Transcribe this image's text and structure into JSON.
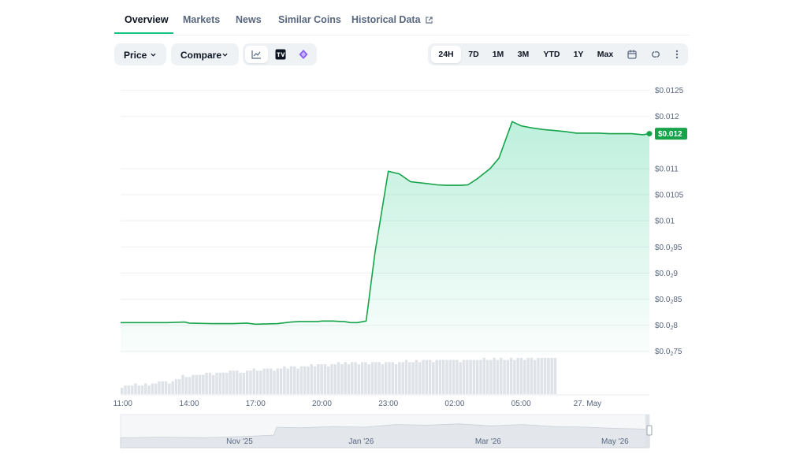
{
  "tabs": [
    {
      "label": "Overview",
      "active": true
    },
    {
      "label": "Markets",
      "active": false
    },
    {
      "label": "News",
      "active": false
    },
    {
      "label": "Similar Coins",
      "active": false
    },
    {
      "label": "Historical Data",
      "active": false,
      "icon": "external-link-icon"
    }
  ],
  "toolbar": {
    "price_label": "Price",
    "compare_label": "Compare",
    "chart_types": [
      {
        "icon": "line-chart-icon",
        "selected": true
      },
      {
        "icon": "tradingview-icon",
        "selected": false
      },
      {
        "icon": "diamond-logo-icon",
        "selected": false
      }
    ],
    "ranges": [
      {
        "label": "24H",
        "selected": true
      },
      {
        "label": "7D",
        "selected": false
      },
      {
        "label": "1M",
        "selected": false
      },
      {
        "label": "3M",
        "selected": false
      },
      {
        "label": "YTD",
        "selected": false
      },
      {
        "label": "1Y",
        "selected": false
      },
      {
        "label": "Max",
        "selected": false
      }
    ],
    "extra_icons": [
      "calendar-icon",
      "link-icon",
      "more-vertical-icon"
    ]
  },
  "colors": {
    "line": "#16a34a",
    "tag": "#16a34a",
    "accent": "#16c784",
    "grid": "#eef0f3",
    "volume": "#dfe3e8"
  },
  "chart_data": {
    "type": "line",
    "ylim": [
      0.00745,
      0.0126
    ],
    "yticks": [
      {
        "v": 0.0125,
        "main": "$0.0125",
        "sub": "",
        "rest": ""
      },
      {
        "v": 0.012,
        "main": "$0.012",
        "sub": "",
        "rest": ""
      },
      {
        "v": 0.011,
        "main": "$0.011",
        "sub": "",
        "rest": ""
      },
      {
        "v": 0.0105,
        "main": "$0.0105",
        "sub": "",
        "rest": ""
      },
      {
        "v": 0.01,
        "main": "$0.01",
        "sub": "",
        "rest": ""
      },
      {
        "v": 0.0095,
        "main": "$0.0",
        "sub": "2",
        "rest": "95"
      },
      {
        "v": 0.009,
        "main": "$0.0",
        "sub": "2",
        "rest": "9"
      },
      {
        "v": 0.0085,
        "main": "$0.0",
        "sub": "2",
        "rest": "85"
      },
      {
        "v": 0.008,
        "main": "$0.0",
        "sub": "2",
        "rest": "8"
      },
      {
        "v": 0.0075,
        "main": "$0.0",
        "sub": "2",
        "rest": "75"
      }
    ],
    "xlim": [
      10.9,
      34.8
    ],
    "xticks": [
      {
        "t": 11,
        "label": "11:00"
      },
      {
        "t": 14,
        "label": "14:00"
      },
      {
        "t": 17,
        "label": "17:00"
      },
      {
        "t": 20,
        "label": "20:00"
      },
      {
        "t": 23,
        "label": "23:00"
      },
      {
        "t": 26,
        "label": "02:00"
      },
      {
        "t": 29,
        "label": "05:00"
      },
      {
        "t": 32,
        "label": "27. May"
      },
      {
        "t": 35,
        "label": "11:00"
      },
      {
        "t": 38,
        "label": "14:00"
      }
    ],
    "x": [
      10.9,
      12,
      13,
      13.8,
      14,
      15,
      16,
      16.6,
      17,
      18,
      18.6,
      19,
      19.8,
      20,
      20.5,
      20.9,
      21,
      21.3,
      21.6,
      22,
      22.4,
      23,
      23.5,
      24,
      24.8,
      25.2,
      25.6,
      26,
      26.3,
      26.6,
      27,
      27.6,
      28,
      28.6,
      29,
      29.5,
      30,
      30.5,
      31,
      31.5,
      32,
      32.5,
      33,
      34,
      34.5,
      34.8
    ],
    "values": [
      0.00805,
      0.00805,
      0.00805,
      0.00806,
      0.00804,
      0.00803,
      0.00803,
      0.00804,
      0.00802,
      0.00803,
      0.00806,
      0.00807,
      0.00807,
      0.00808,
      0.00808,
      0.00807,
      0.00807,
      0.00805,
      0.00805,
      0.00808,
      0.0094,
      0.01095,
      0.0109,
      0.01075,
      0.01071,
      0.01069,
      0.01068,
      0.01068,
      0.01068,
      0.01069,
      0.0108,
      0.011,
      0.0112,
      0.0119,
      0.01182,
      0.01178,
      0.01175,
      0.01173,
      0.01171,
      0.01168,
      0.01168,
      0.01168,
      0.01167,
      0.01167,
      0.01165,
      0.01167
    ],
    "price_tag": "$0.012",
    "volume": [
      3,
      4,
      4,
      4,
      5,
      4,
      4,
      5,
      4,
      5,
      5,
      6,
      6,
      6,
      5,
      6,
      7,
      7,
      9,
      8,
      8,
      9,
      9,
      9,
      9,
      10,
      10,
      9,
      10,
      10,
      10,
      10,
      11,
      11,
      11,
      10,
      10,
      11,
      11,
      12,
      11,
      11,
      12,
      12,
      12,
      11,
      12,
      12,
      13,
      12,
      13,
      13,
      12,
      13,
      13,
      13,
      14,
      13,
      14,
      14,
      14,
      13,
      14,
      14,
      15,
      14,
      15,
      14,
      15,
      15,
      14,
      15,
      15,
      14,
      15,
      15,
      15,
      14,
      15,
      15,
      15,
      14,
      15,
      15,
      16,
      15,
      15,
      16,
      15,
      16,
      16,
      16,
      15,
      16,
      16,
      16,
      16,
      16,
      16,
      16,
      15,
      16,
      16,
      16,
      16,
      16,
      16,
      17,
      16,
      16,
      17,
      16,
      17,
      16,
      16,
      17,
      16,
      17,
      17,
      16,
      17,
      17,
      16,
      17,
      17,
      17,
      17,
      17,
      17
    ],
    "navigator_labels": [
      {
        "t": 0.225,
        "label": "Nov '25"
      },
      {
        "t": 0.455,
        "label": "Jan '26"
      },
      {
        "t": 0.695,
        "label": "Mar '26"
      },
      {
        "t": 0.935,
        "label": "May '26"
      }
    ]
  }
}
